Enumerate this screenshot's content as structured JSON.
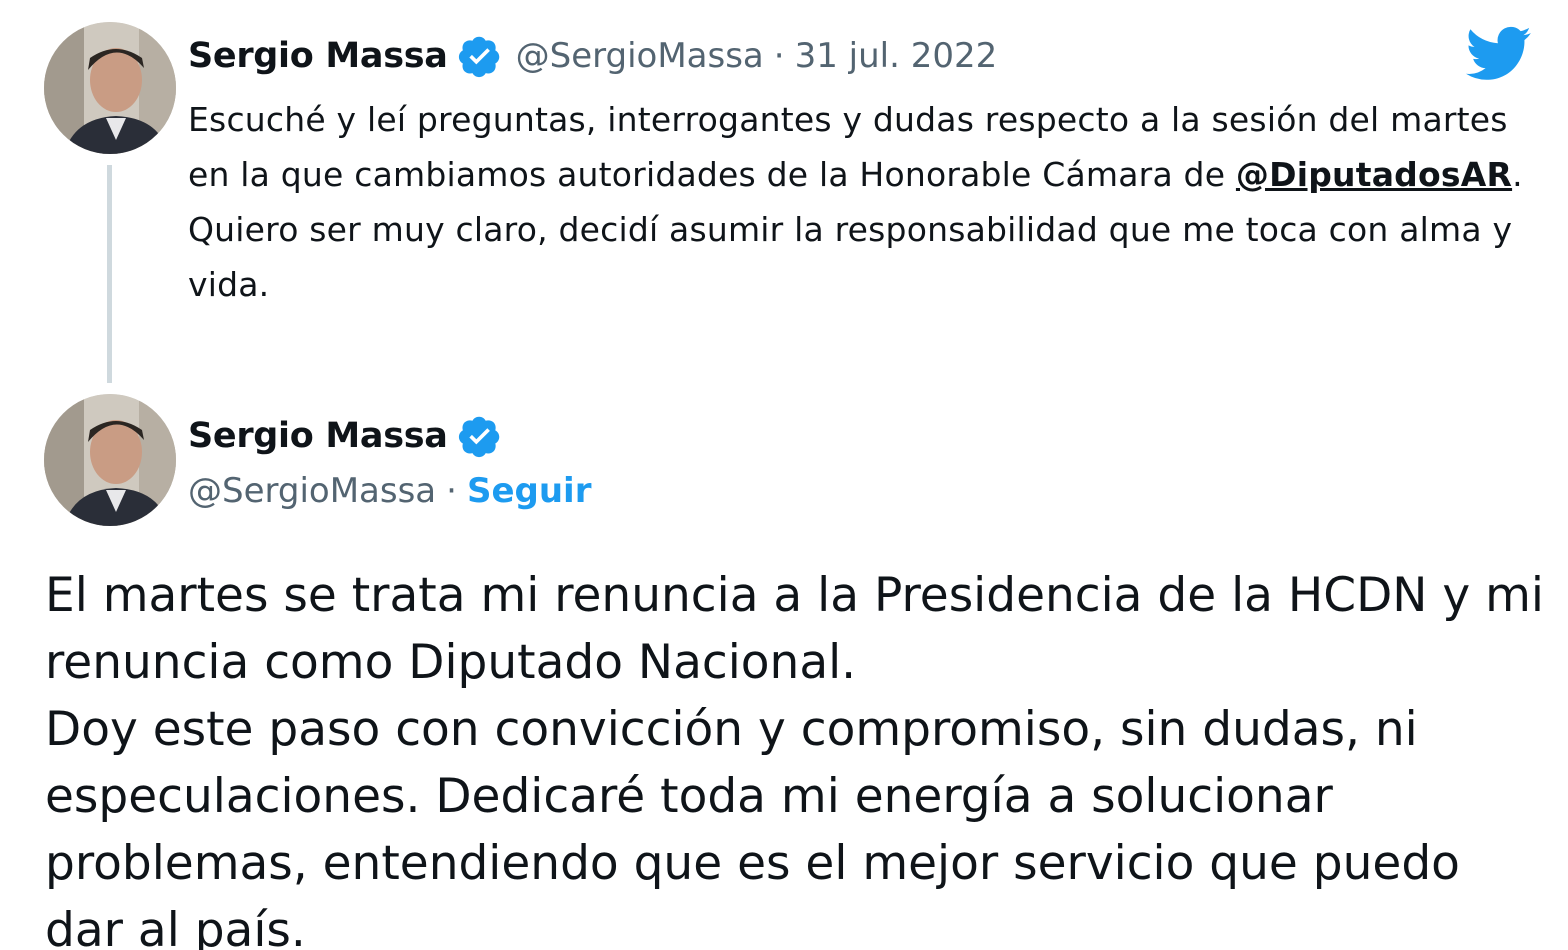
{
  "quoted_tweet": {
    "author_name": "Sergio Massa",
    "handle": "@SergioMassa",
    "separator": "·",
    "date": "31 jul. 2022",
    "text_line1": "Escuché y leí preguntas, interrogantes y dudas respecto a la sesión del martes en la que cambiamos autoridades de la Honorable Cámara de",
    "mention": "@DiputadosAR",
    "mention_suffix": ".",
    "text_line2": "Quiero ser muy claro, decidí asumir la responsabilidad que me toca con alma y vida."
  },
  "main_tweet": {
    "author_name": "Sergio Massa",
    "handle": "@SergioMassa",
    "separator": "·",
    "follow_label": "Seguir",
    "text_para1": "El martes se trata mi renuncia a la Presidencia de la HCDN y mi renuncia como Diputado Nacional.",
    "text_para2": "Doy este paso con convicción y compromiso, sin dudas, ni especulaciones. Dedicaré toda mi energía a solucionar problemas, entendiendo que es el mejor servicio que puedo dar al país."
  },
  "colors": {
    "brand_blue": "#1d9bf0",
    "secondary_text": "#536471",
    "primary_text": "#0f1419",
    "thread_line": "#cfd9de"
  },
  "icons": {
    "verified": "verified-badge-icon",
    "logo": "twitter-bird-icon"
  }
}
